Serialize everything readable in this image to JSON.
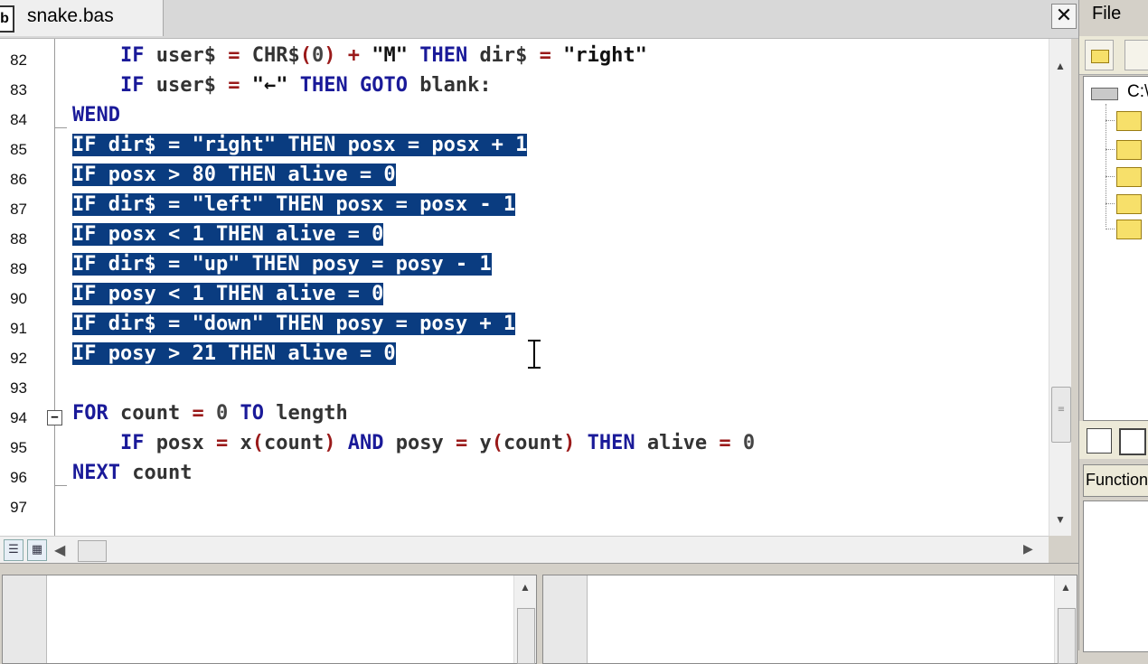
{
  "tab": {
    "icon": "b",
    "label": "snake.bas",
    "close_glyph": "✕"
  },
  "menu": {
    "file": "File"
  },
  "explorer": {
    "drive_label": "C:\\",
    "function_tab": "Function"
  },
  "lines": [
    {
      "num": "82",
      "text": "    IF user$ = CHR$(0) + \"M\" THEN dir$ = \"right\""
    },
    {
      "num": "83",
      "text": "    IF user$ = \"←\" THEN GOTO blank:"
    },
    {
      "num": "84",
      "text": "WEND"
    },
    {
      "num": "85",
      "text": "IF dir$ = \"right\" THEN posx = posx + 1"
    },
    {
      "num": "86",
      "text": "IF posx > 80 THEN alive = 0"
    },
    {
      "num": "87",
      "text": "IF dir$ = \"left\" THEN posx = posx - 1"
    },
    {
      "num": "88",
      "text": "IF posx < 1 THEN alive = 0"
    },
    {
      "num": "89",
      "text": "IF dir$ = \"up\" THEN posy = posy - 1"
    },
    {
      "num": "90",
      "text": "IF posy < 1 THEN alive = 0"
    },
    {
      "num": "91",
      "text": "IF dir$ = \"down\" THEN posy = posy + 1"
    },
    {
      "num": "92",
      "text": "IF posy > 21 THEN alive = 0"
    },
    {
      "num": "93",
      "text": ""
    },
    {
      "num": "94",
      "text": "FOR count = 0 TO length"
    },
    {
      "num": "95",
      "text": "    IF posx = x(count) AND posy = y(count) THEN alive = 0"
    },
    {
      "num": "96",
      "text": "NEXT count"
    },
    {
      "num": "97",
      "text": ""
    }
  ],
  "icons": {
    "close": "close-icon",
    "fold_collapse": "minus-box-icon",
    "scroll_up": "arrow-up-icon",
    "scroll_down": "arrow-down-icon",
    "scroll_left": "arrow-left-icon",
    "scroll_right": "arrow-right-icon",
    "folder": "folder-icon",
    "drive": "drive-icon"
  },
  "colors": {
    "selection": "#0a3c80",
    "keyword": "#1a1a99",
    "operator": "#9a1a1a"
  }
}
